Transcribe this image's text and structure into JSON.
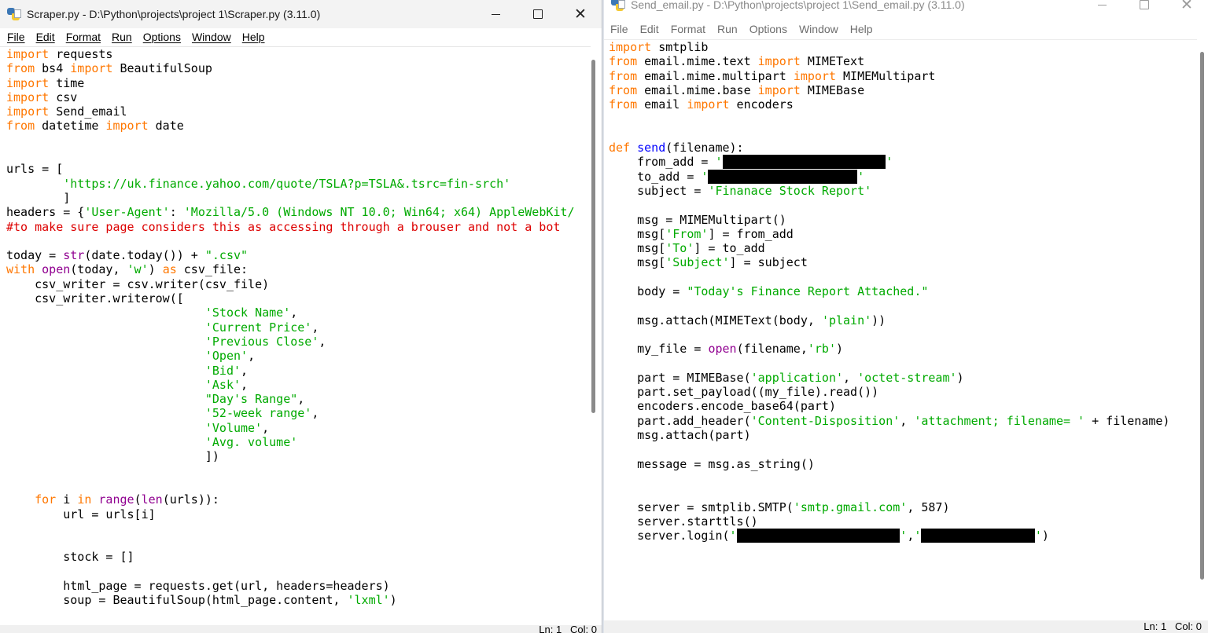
{
  "left_window": {
    "title": "Scraper.py - D:\\Python\\projects\\project 1\\Scraper.py (3.11.0)",
    "menu": [
      "File",
      "Edit",
      "Format",
      "Run",
      "Options",
      "Window",
      "Help"
    ],
    "status": "Ln: 1   Col: 0"
  },
  "right_window": {
    "title": "Send_email.py - D:\\Python\\projects\\project 1\\Send_email.py (3.11.0)",
    "menu": [
      "File",
      "Edit",
      "Format",
      "Run",
      "Options",
      "Window",
      "Help"
    ],
    "status": "Ln: 1   Col: 0"
  },
  "colors": {
    "keyword": "#ff7700",
    "string": "#00aa00",
    "builtin": "#900090",
    "comment": "#dd0000",
    "definition": "#0000ff"
  },
  "left_code": [
    [
      [
        "k",
        "import"
      ],
      [
        "t",
        " requests"
      ]
    ],
    [
      [
        "k",
        "from"
      ],
      [
        "t",
        " bs4 "
      ],
      [
        "k",
        "import"
      ],
      [
        "t",
        " BeautifulSoup"
      ]
    ],
    [
      [
        "k",
        "import"
      ],
      [
        "t",
        " time"
      ]
    ],
    [
      [
        "k",
        "import"
      ],
      [
        "t",
        " csv"
      ]
    ],
    [
      [
        "k",
        "import"
      ],
      [
        "t",
        " Send_email"
      ]
    ],
    [
      [
        "k",
        "from"
      ],
      [
        "t",
        " datetime "
      ],
      [
        "k",
        "import"
      ],
      [
        "t",
        " date"
      ]
    ],
    [],
    [],
    [
      [
        "t",
        "urls = ["
      ]
    ],
    [
      [
        "t",
        "        "
      ],
      [
        "s",
        "'https://uk.finance.yahoo.com/quote/TSLA?p=TSLA&.tsrc=fin-srch'"
      ]
    ],
    [
      [
        "t",
        "        ]"
      ]
    ],
    [
      [
        "t",
        "headers = {"
      ],
      [
        "s",
        "'User-Agent'"
      ],
      [
        "t",
        ": "
      ],
      [
        "s",
        "'Mozilla/5.0 (Windows NT 10.0; Win64; x64) AppleWebKit/"
      ]
    ],
    [
      [
        "c",
        "#to make sure page considers this as accessing through a brouser and not a bot"
      ]
    ],
    [],
    [
      [
        "t",
        "today = "
      ],
      [
        "b",
        "str"
      ],
      [
        "t",
        "(date.today()) + "
      ],
      [
        "s",
        "\".csv\""
      ]
    ],
    [
      [
        "k",
        "with"
      ],
      [
        "t",
        " "
      ],
      [
        "b",
        "open"
      ],
      [
        "t",
        "(today, "
      ],
      [
        "s",
        "'w'"
      ],
      [
        "t",
        ") "
      ],
      [
        "k",
        "as"
      ],
      [
        "t",
        " csv_file:"
      ]
    ],
    [
      [
        "t",
        "    csv_writer = csv.writer(csv_file)"
      ]
    ],
    [
      [
        "t",
        "    csv_writer.writerow(["
      ]
    ],
    [
      [
        "t",
        "                            "
      ],
      [
        "s",
        "'Stock Name'"
      ],
      [
        "t",
        ","
      ]
    ],
    [
      [
        "t",
        "                            "
      ],
      [
        "s",
        "'Current Price'"
      ],
      [
        "t",
        ","
      ]
    ],
    [
      [
        "t",
        "                            "
      ],
      [
        "s",
        "'Previous Close'"
      ],
      [
        "t",
        ","
      ]
    ],
    [
      [
        "t",
        "                            "
      ],
      [
        "s",
        "'Open'"
      ],
      [
        "t",
        ","
      ]
    ],
    [
      [
        "t",
        "                            "
      ],
      [
        "s",
        "'Bid'"
      ],
      [
        "t",
        ","
      ]
    ],
    [
      [
        "t",
        "                            "
      ],
      [
        "s",
        "'Ask'"
      ],
      [
        "t",
        ","
      ]
    ],
    [
      [
        "t",
        "                            "
      ],
      [
        "s",
        "\"Day's Range\""
      ],
      [
        "t",
        ","
      ]
    ],
    [
      [
        "t",
        "                            "
      ],
      [
        "s",
        "'52-week range'"
      ],
      [
        "t",
        ","
      ]
    ],
    [
      [
        "t",
        "                            "
      ],
      [
        "s",
        "'Volume'"
      ],
      [
        "t",
        ","
      ]
    ],
    [
      [
        "t",
        "                            "
      ],
      [
        "s",
        "'Avg. volume'"
      ]
    ],
    [
      [
        "t",
        "                            ])"
      ]
    ],
    [],
    [],
    [
      [
        "t",
        "    "
      ],
      [
        "k",
        "for"
      ],
      [
        "t",
        " i "
      ],
      [
        "k",
        "in"
      ],
      [
        "t",
        " "
      ],
      [
        "b",
        "range"
      ],
      [
        "t",
        "("
      ],
      [
        "b",
        "len"
      ],
      [
        "t",
        "(urls)):"
      ]
    ],
    [
      [
        "t",
        "        url = urls[i]"
      ]
    ],
    [],
    [],
    [
      [
        "t",
        "        stock = []"
      ]
    ],
    [],
    [
      [
        "t",
        "        html_page = requests.get(url, headers=headers)"
      ]
    ],
    [
      [
        "t",
        "        soup = BeautifulSoup(html_page.content, "
      ],
      [
        "s",
        "'lxml'"
      ],
      [
        "t",
        ")"
      ]
    ]
  ],
  "right_code": [
    [
      [
        "k",
        "import"
      ],
      [
        "t",
        " smtplib"
      ]
    ],
    [
      [
        "k",
        "from"
      ],
      [
        "t",
        " email.mime.text "
      ],
      [
        "k",
        "import"
      ],
      [
        "t",
        " MIMEText"
      ]
    ],
    [
      [
        "k",
        "from"
      ],
      [
        "t",
        " email.mime.multipart "
      ],
      [
        "k",
        "import"
      ],
      [
        "t",
        " MIMEMultipart"
      ]
    ],
    [
      [
        "k",
        "from"
      ],
      [
        "t",
        " email.mime.base "
      ],
      [
        "k",
        "import"
      ],
      [
        "t",
        " MIMEBase"
      ]
    ],
    [
      [
        "k",
        "from"
      ],
      [
        "t",
        " email "
      ],
      [
        "k",
        "import"
      ],
      [
        "t",
        " encoders"
      ]
    ],
    [],
    [],
    [
      [
        "k",
        "def"
      ],
      [
        "t",
        " "
      ],
      [
        "d",
        "send"
      ],
      [
        "t",
        "(filename):"
      ]
    ],
    [
      [
        "t",
        "    from_add = "
      ],
      [
        "s",
        "'"
      ],
      [
        "r",
        "xxxxxxxxxxxxxxxxxxxxxxx"
      ],
      [
        "s",
        "'"
      ]
    ],
    [
      [
        "t",
        "    to_add = "
      ],
      [
        "s",
        "'"
      ],
      [
        "r",
        "xxxxxxxxxxxxxxxxxxxxx"
      ],
      [
        "s",
        "'"
      ]
    ],
    [
      [
        "t",
        "    subject = "
      ],
      [
        "s",
        "'Finanace Stock Report'"
      ]
    ],
    [],
    [
      [
        "t",
        "    msg = MIMEMultipart()"
      ]
    ],
    [
      [
        "t",
        "    msg["
      ],
      [
        "s",
        "'From'"
      ],
      [
        "t",
        "] = from_add"
      ]
    ],
    [
      [
        "t",
        "    msg["
      ],
      [
        "s",
        "'To'"
      ],
      [
        "t",
        "] = to_add"
      ]
    ],
    [
      [
        "t",
        "    msg["
      ],
      [
        "s",
        "'Subject'"
      ],
      [
        "t",
        "] = subject"
      ]
    ],
    [],
    [
      [
        "t",
        "    body = "
      ],
      [
        "s",
        "\"Today's Finance Report Attached.\""
      ]
    ],
    [],
    [
      [
        "t",
        "    msg.attach(MIMEText(body, "
      ],
      [
        "s",
        "'plain'"
      ],
      [
        "t",
        "))"
      ]
    ],
    [],
    [
      [
        "t",
        "    my_file = "
      ],
      [
        "b",
        "open"
      ],
      [
        "t",
        "(filename,"
      ],
      [
        "s",
        "'rb'"
      ],
      [
        "t",
        ")"
      ]
    ],
    [],
    [
      [
        "t",
        "    part = MIMEBase("
      ],
      [
        "s",
        "'application'"
      ],
      [
        "t",
        ", "
      ],
      [
        "s",
        "'octet-stream'"
      ],
      [
        "t",
        ")"
      ]
    ],
    [
      [
        "t",
        "    part.set_payload((my_file).read())"
      ]
    ],
    [
      [
        "t",
        "    encoders.encode_base64(part)"
      ]
    ],
    [
      [
        "t",
        "    part.add_header("
      ],
      [
        "s",
        "'Content-Disposition'"
      ],
      [
        "t",
        ", "
      ],
      [
        "s",
        "'attachment; filename= '"
      ],
      [
        "t",
        " + filename)"
      ]
    ],
    [
      [
        "t",
        "    msg.attach(part)"
      ]
    ],
    [],
    [
      [
        "t",
        "    message = msg.as_string()"
      ]
    ],
    [],
    [],
    [
      [
        "t",
        "    server = smtplib.SMTP("
      ],
      [
        "s",
        "'smtp.gmail.com'"
      ],
      [
        "t",
        ", 587)"
      ]
    ],
    [
      [
        "t",
        "    server.starttls()"
      ]
    ],
    [
      [
        "t",
        "    server.login("
      ],
      [
        "s",
        "'"
      ],
      [
        "r",
        "xxxxxxxxxxxxxxxxxxxxxxx"
      ],
      [
        "s",
        "'"
      ],
      [
        "t",
        ","
      ],
      [
        "s",
        "'"
      ],
      [
        "r",
        "xxxxxxxxxxxxxxxx"
      ],
      [
        "s",
        "'"
      ],
      [
        "t",
        ")"
      ]
    ]
  ]
}
